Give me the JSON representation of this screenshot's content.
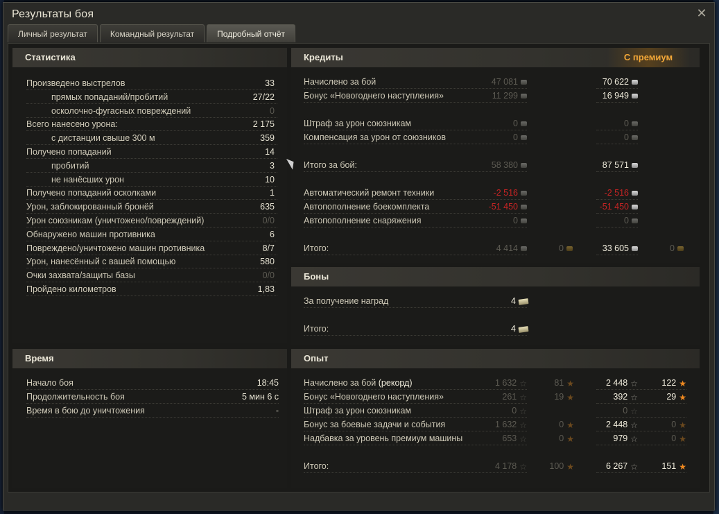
{
  "window": {
    "title": "Результаты боя",
    "close_icon": "close-icon"
  },
  "tabs": [
    {
      "label": "Личный результат",
      "active": false
    },
    {
      "label": "Командный результат",
      "active": false
    },
    {
      "label": "Подробный отчёт",
      "active": true
    }
  ],
  "statistics": {
    "header": "Статистика",
    "rows": [
      {
        "label": "Произведено выстрелов",
        "value": "33",
        "indent": false,
        "dim": false
      },
      {
        "label": "прямых попаданий/пробитий",
        "value": "27/22",
        "indent": true,
        "dim": false
      },
      {
        "label": "осколочно-фугасных повреждений",
        "value": "0",
        "indent": true,
        "dim": true
      },
      {
        "label": "Всего нанесено урона:",
        "value": "2 175",
        "indent": false,
        "dim": false
      },
      {
        "label": "с дистанции свыше 300 м",
        "value": "359",
        "indent": true,
        "dim": false
      },
      {
        "label": "Получено попаданий",
        "value": "14",
        "indent": false,
        "dim": false
      },
      {
        "label": "пробитий",
        "value": "3",
        "indent": true,
        "dim": false
      },
      {
        "label": "не нанёсших урон",
        "value": "10",
        "indent": true,
        "dim": false
      },
      {
        "label": "Получено попаданий осколками",
        "value": "1",
        "indent": false,
        "dim": false
      },
      {
        "label": "Урон, заблокированный бронёй",
        "value": "635",
        "indent": false,
        "dim": false
      },
      {
        "label": "Урон союзникам (уничтожено/повреждений)",
        "value": "0/0",
        "indent": false,
        "dim": true
      },
      {
        "label": "Обнаружено машин противника",
        "value": "6",
        "indent": false,
        "dim": false
      },
      {
        "label": "Повреждено/уничтожено машин противника",
        "value": "8/7",
        "indent": false,
        "dim": false
      },
      {
        "label": "Урон, нанесённый с вашей помощью",
        "value": "580",
        "indent": false,
        "dim": false
      },
      {
        "label": "Очки захвата/защиты базы",
        "value": "0/0",
        "indent": false,
        "dim": true
      },
      {
        "label": "Пройдено километров",
        "value": "1,83",
        "indent": false,
        "dim": false
      }
    ]
  },
  "time": {
    "header": "Время",
    "rows": [
      {
        "label": "Начало боя",
        "value": "18:45"
      },
      {
        "label": "Продолжительность боя",
        "value": "5 мин 6 с"
      },
      {
        "label": "Время в бою до уничтожения",
        "value": "-"
      }
    ]
  },
  "credits": {
    "header": "Кредиты",
    "premium_label": "С премиум",
    "rows": [
      {
        "label": "Начислено за бой",
        "base": "47 081",
        "base_gold": null,
        "prem": "70 622",
        "prem_gold": null,
        "base_cls": "dim",
        "prem_cls": "bright",
        "gap_before": false
      },
      {
        "label": "Бонус «Новогоднего наступления»",
        "base": "11 299",
        "base_gold": null,
        "prem": "16 949",
        "prem_gold": null,
        "base_cls": "dim",
        "prem_cls": "bright",
        "gap_before": false
      },
      {
        "label": "Штраф за урон союзникам",
        "base": "0",
        "base_gold": null,
        "prem": "0",
        "prem_gold": null,
        "base_cls": "dim",
        "prem_cls": "dim",
        "gap_before": true
      },
      {
        "label": "Компенсация за урон от союзников",
        "base": "0",
        "base_gold": null,
        "prem": "0",
        "prem_gold": null,
        "base_cls": "dim",
        "prem_cls": "dim",
        "gap_before": false
      },
      {
        "label": "Итого за бой:",
        "base": "58 380",
        "base_gold": null,
        "prem": "87 571",
        "prem_gold": null,
        "base_cls": "dim",
        "prem_cls": "bright",
        "gap_before": true
      },
      {
        "label": "Автоматический ремонт техники",
        "base": "-2 516",
        "base_gold": null,
        "prem": "-2 516",
        "prem_gold": null,
        "base_cls": "red dim",
        "prem_cls": "red",
        "gap_before": true
      },
      {
        "label": "Автопополнение боекомплекта",
        "base": "-51 450",
        "base_gold": null,
        "prem": "-51 450",
        "prem_gold": null,
        "base_cls": "red dim",
        "prem_cls": "red",
        "gap_before": false
      },
      {
        "label": "Автопополнение снаряжения",
        "base": "0",
        "base_gold": null,
        "prem": "0",
        "prem_gold": null,
        "base_cls": "dim",
        "prem_cls": "dim",
        "gap_before": false
      },
      {
        "label": "Итого:",
        "base": "4 414",
        "base_gold": "0",
        "prem": "33 605",
        "prem_gold": "0",
        "base_cls": "dim",
        "prem_cls": "bright",
        "gap_before": true
      }
    ]
  },
  "bonds": {
    "header": "Боны",
    "rows": [
      {
        "label": "За получение наград",
        "value": "4"
      },
      {
        "label": "Итого:",
        "value": "4"
      }
    ]
  },
  "experience": {
    "header": "Опыт",
    "rows": [
      {
        "label": "Начислено за бой",
        "label_suffix": "(рекорд)",
        "base": "1 632",
        "base_free": "81",
        "prem": "2 448",
        "prem_free": "122",
        "base_free_dim": true,
        "prem_dim": false,
        "prem_free_dim": false
      },
      {
        "label": "Бонус «Новогоднего наступления»",
        "label_suffix": "",
        "base": "261",
        "base_free": "19",
        "prem": "392",
        "prem_free": "29",
        "base_free_dim": true,
        "prem_dim": false,
        "prem_free_dim": false
      },
      {
        "label": "Штраф за урон союзникам",
        "label_suffix": "",
        "base": "0",
        "base_free": null,
        "prem": "0",
        "prem_free": null,
        "base_free_dim": true,
        "prem_dim": true,
        "prem_free_dim": true
      },
      {
        "label": "Бонус за боевые задачи и события",
        "label_suffix": "",
        "base": "1 632",
        "base_free": "0",
        "prem": "2 448",
        "prem_free": "0",
        "base_free_dim": true,
        "prem_dim": false,
        "prem_free_dim": true
      },
      {
        "label": "Надбавка за уровень премиум машины",
        "label_suffix": "",
        "base": "653",
        "base_free": "0",
        "prem": "979",
        "prem_free": "0",
        "base_free_dim": true,
        "prem_dim": false,
        "prem_free_dim": true
      },
      {
        "label": "Итого:",
        "label_suffix": "",
        "base": "4 178",
        "base_free": "100",
        "prem": "6 267",
        "prem_free": "151",
        "base_free_dim": true,
        "prem_dim": false,
        "prem_free_dim": false
      }
    ]
  },
  "colors": {
    "accent_premium": "#f4a838",
    "negative": "#c82424",
    "text": "#cfcab8",
    "panel": "#1b1b19"
  }
}
